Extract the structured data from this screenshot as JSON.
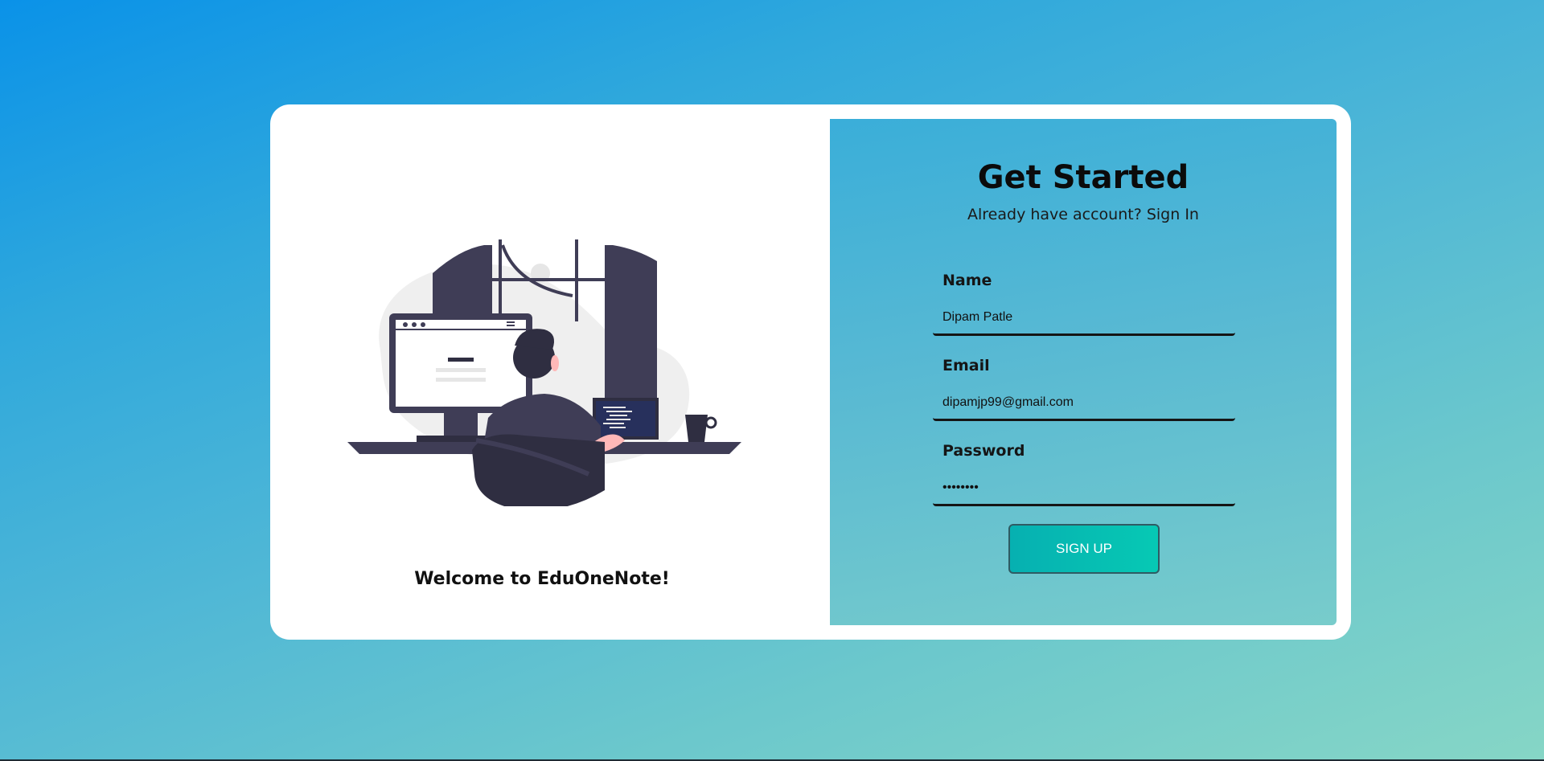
{
  "left": {
    "welcome_text": "Welcome to EduOneNote!",
    "illustration_icon": "person-at-desk-illustration"
  },
  "form": {
    "heading": "Get Started",
    "signin_prompt": "Already have account?",
    "signin_link": "Sign In",
    "name_label": "Name",
    "name_value": "Dipam Patle",
    "email_label": "Email",
    "email_value": "dipamjp99@gmail.com",
    "password_label": "Password",
    "password_value": "••••••••",
    "submit_label": "SIGN UP"
  },
  "colors": {
    "background_start": "#0a92e8",
    "background_end": "#86d6c6",
    "form_panel": "#58b9d3",
    "button": "#06c9b4"
  }
}
